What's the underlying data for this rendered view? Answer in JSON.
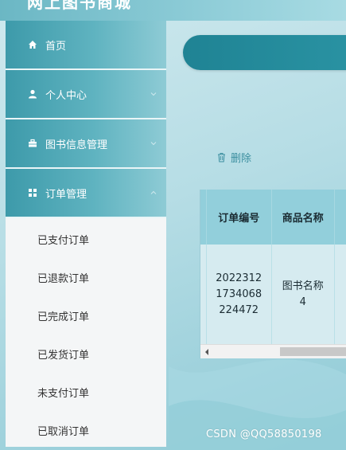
{
  "header": {
    "brand": "网上图书商城"
  },
  "sidebar": {
    "items": [
      {
        "label": "首页",
        "icon": "home-icon"
      },
      {
        "label": "个人中心",
        "icon": "user-icon"
      },
      {
        "label": "图书信息管理",
        "icon": "briefcase-icon"
      },
      {
        "label": "订单管理",
        "icon": "grid-icon"
      }
    ],
    "submenu": [
      {
        "label": "已支付订单"
      },
      {
        "label": "已退款订单"
      },
      {
        "label": "已完成订单"
      },
      {
        "label": "已发货订单"
      },
      {
        "label": "未支付订单"
      },
      {
        "label": "已取消订单"
      }
    ]
  },
  "toolbar": {
    "delete_label": "删除"
  },
  "table": {
    "columns": [
      "订单编号",
      "商品名称"
    ],
    "rows": [
      {
        "order_no_line1": "2022312",
        "order_no_line2": "1734068",
        "order_no_line3": "224472",
        "name_line1": "图书名称",
        "name_line2": "4"
      }
    ]
  },
  "watermark": "CSDN @QQ58850198",
  "colors": {
    "accent": "#2a93a3",
    "sidebar": "#5fb3c0",
    "submenu_bg": "#f4f6f7"
  }
}
